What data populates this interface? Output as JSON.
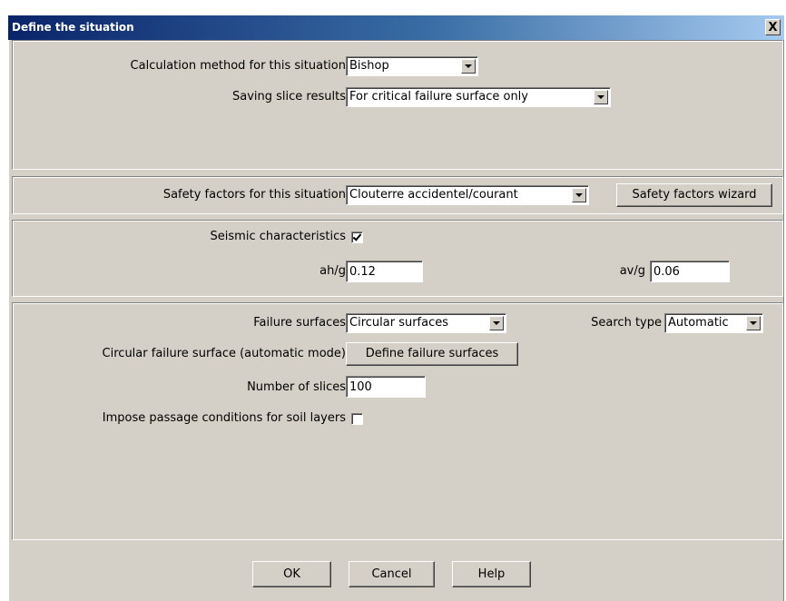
{
  "window": {
    "title": "Define the situation",
    "close_glyph": "X"
  },
  "calculation": {
    "method_label": "Calculation method for this situation",
    "method_value": "Bishop",
    "saving_label": "Saving slice results",
    "saving_value": "For critical failure surface only"
  },
  "safety": {
    "label": "Safety factors for this situation",
    "value": "Clouterre accidentel/courant",
    "wizard_button": "Safety factors wizard"
  },
  "seismic": {
    "label": "Seismic characteristics",
    "checked": true,
    "ahg_label": "ah/g",
    "ahg_value": "0.12",
    "avg_label": "av/g",
    "avg_value": "0.06"
  },
  "failure": {
    "surfaces_label": "Failure surfaces",
    "surfaces_value": "Circular surfaces",
    "search_label": "Search type",
    "search_value": "Automatic",
    "circular_label": "Circular failure surface (automatic mode)",
    "define_button": "Define failure surfaces",
    "slices_label": "Number of slices",
    "slices_value": "100",
    "passage_label": "Impose passage conditions for soil layers",
    "passage_checked": false
  },
  "buttons": {
    "ok": "OK",
    "cancel": "Cancel",
    "help": "Help"
  }
}
